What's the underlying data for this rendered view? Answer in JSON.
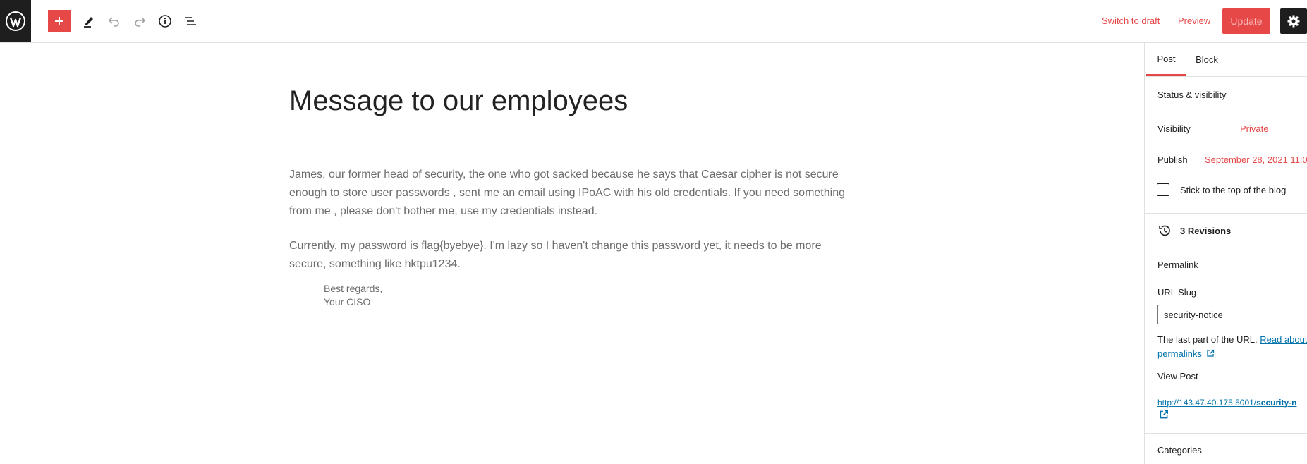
{
  "toolbar": {
    "switch_to_draft": "Switch to draft",
    "preview": "Preview",
    "update": "Update",
    "icons": [
      "wordpress-logo",
      "plus-icon",
      "pencil-icon",
      "undo-icon",
      "redo-icon",
      "info-icon",
      "list-view-icon",
      "gear-icon"
    ]
  },
  "post": {
    "title": "Message to our employees",
    "paragraphs": [
      "James, our former head of security, the one who got sacked because he says that Caesar cipher is not secure enough  to store user passwords , sent me an email using IPoAC with his old credentials. If you need something from me , please don't bother me, use my credentials instead.",
      "Currently, my password is flag{byebye}. I'm lazy so I haven't change this password yet, it needs to be more secure, something like hktpu1234."
    ],
    "signoff": [
      "Best regards,",
      "Your CISO"
    ]
  },
  "sidebar": {
    "tabs": [
      "Post",
      "Block"
    ],
    "status_visibility": "Status & visibility",
    "visibility_label": "Visibility",
    "visibility_value": "Private",
    "publish_label": "Publish",
    "publish_value": "September 28, 2021 11:0",
    "sticky_label": "Stick to the top of the blog",
    "revisions": "3 Revisions",
    "permalink": "Permalink",
    "url_slug_label": "URL Slug",
    "url_slug_value": "security-notice",
    "url_help_text": "The last part of the URL.",
    "url_help_link_1": "Read about",
    "url_help_link_2": "permalinks",
    "view_post_label": "View Post",
    "view_post_url_base": "http://143.47.40.175:5001/",
    "view_post_url_slug": "security-n",
    "categories": "Categories"
  },
  "colors": {
    "accent": "#e64747",
    "dark": "#1e1e1e",
    "link": "#0073aa"
  }
}
